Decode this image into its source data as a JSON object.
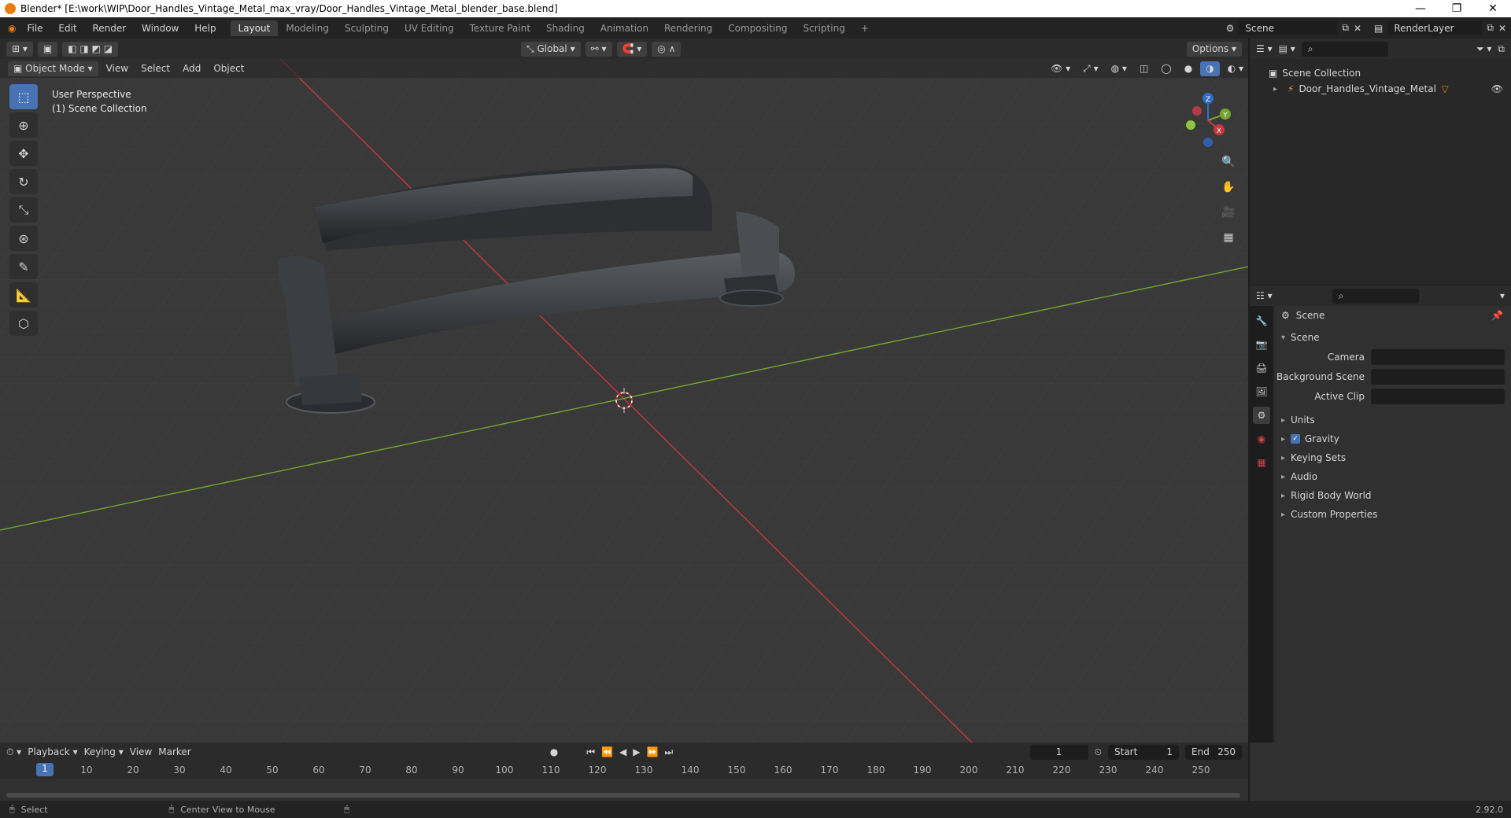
{
  "title_bar": {
    "text": "Blender* [E:\\work\\WIP\\Door_Handles_Vintage_Metal_max_vray/Door_Handles_Vintage_Metal_blender_base.blend]",
    "minimize": "—",
    "maximize": "❐",
    "close": "✕"
  },
  "menu": [
    "File",
    "Edit",
    "Render",
    "Window",
    "Help"
  ],
  "workspaces": [
    "Layout",
    "Modeling",
    "Sculpting",
    "UV Editing",
    "Texture Paint",
    "Shading",
    "Animation",
    "Rendering",
    "Compositing",
    "Scripting"
  ],
  "active_workspace": "Layout",
  "scene_name": "Scene",
  "render_layer": "RenderLayer",
  "viewport": {
    "transform_orientation": "Global",
    "options_label": "Options",
    "mode": "Object Mode",
    "header_menus": [
      "View",
      "Select",
      "Add",
      "Object"
    ],
    "perspective": "User Perspective",
    "collection": "(1) Scene Collection",
    "axis_labels": {
      "x": "X",
      "y": "Y",
      "z": "Z"
    }
  },
  "outliner": {
    "root": "Scene Collection",
    "items": [
      "Door_Handles_Vintage_Metal"
    ]
  },
  "properties": {
    "title": "Scene",
    "section": "Scene",
    "fields": [
      {
        "label": "Camera"
      },
      {
        "label": "Background Scene"
      },
      {
        "label": "Active Clip"
      }
    ],
    "panels": [
      "Units",
      "Gravity",
      "Keying Sets",
      "Audio",
      "Rigid Body World",
      "Custom Properties"
    ]
  },
  "timeline": {
    "menus": [
      "Playback",
      "Keying",
      "View",
      "Marker"
    ],
    "current_frame": "1",
    "start_label": "Start",
    "start": "1",
    "end_label": "End",
    "end": "250",
    "ticks": [
      "1",
      "10",
      "20",
      "30",
      "40",
      "50",
      "60",
      "70",
      "80",
      "90",
      "100",
      "110",
      "120",
      "130",
      "140",
      "150",
      "160",
      "170",
      "180",
      "190",
      "200",
      "210",
      "220",
      "230",
      "240",
      "250"
    ]
  },
  "status": {
    "select": "Select",
    "center_view": "Center View to Mouse",
    "version": "2.92.0"
  },
  "colors": {
    "accent": "#4772b3",
    "x_axis": "#c8373d",
    "y_axis": "#74a530",
    "z_axis": "#2f6ec6"
  }
}
